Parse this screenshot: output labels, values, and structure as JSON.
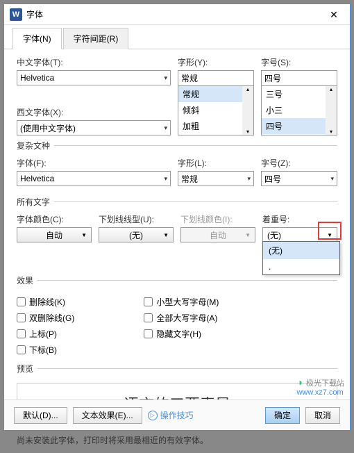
{
  "title": "字体",
  "close": "✕",
  "tabs": {
    "font": "字体(N)",
    "spacing": "字符间距(R)"
  },
  "section1": {
    "cn_font_label": "中文字体(T):",
    "cn_font_value": "Helvetica",
    "west_font_label": "西文字体(X):",
    "west_font_value": "(使用中文字体)",
    "style_label": "字形(Y):",
    "style_value": "常规",
    "style_options": [
      "常规",
      "倾斜",
      "加粗"
    ],
    "size_label": "字号(S):",
    "size_value": "四号",
    "size_options": [
      "三号",
      "小三",
      "四号"
    ]
  },
  "complex": {
    "legend": "复杂文种",
    "font_label": "字体(F):",
    "font_value": "Helvetica",
    "style_label": "字形(L):",
    "style_value": "常规",
    "size_label": "字号(Z):",
    "size_value": "四号"
  },
  "allText": {
    "legend": "所有文字",
    "color_label": "字体颜色(C):",
    "color_value": "自动",
    "underline_label": "下划线线型(U):",
    "underline_value": "(无)",
    "underline_color_label": "下划线颜色(I):",
    "underline_color_value": "自动",
    "emphasis_label": "着重号:",
    "emphasis_value": "(无)",
    "emphasis_options": [
      "(无)",
      "."
    ]
  },
  "effects": {
    "legend": "效果",
    "strike": "删除线(K)",
    "dbl_strike": "双删除线(G)",
    "superscript": "上标(P)",
    "subscript": "下标(B)",
    "small_caps": "小型大写字母(M)",
    "all_caps": "全部大写字母(A)",
    "hidden": "隐藏文字(H)"
  },
  "preview": {
    "legend": "预览",
    "text": "语言的三要素是"
  },
  "note": "尚未安装此字体，打印时将采用最相近的有效字体。",
  "footer": {
    "default": "默认(D)...",
    "text_effect": "文本效果(E)...",
    "tips": "操作技巧",
    "ok": "确定",
    "cancel": "取消"
  },
  "watermark": {
    "brand": "极光下载站",
    "url": "www.xz7.com"
  }
}
